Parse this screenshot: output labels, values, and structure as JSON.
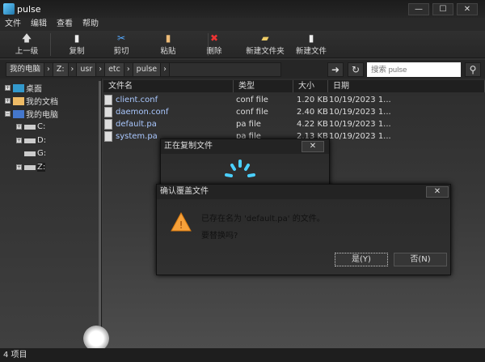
{
  "window": {
    "title": "pulse",
    "minimize": "—",
    "maximize": "☐",
    "close": "✕"
  },
  "menu": [
    "文件",
    "编辑",
    "查看",
    "帮助"
  ],
  "toolbar": {
    "up": "上一级",
    "copy": "复制",
    "cut": "剪切",
    "paste": "粘贴",
    "delete": "删除",
    "new_folder": "新建文件夹",
    "new_file": "新建文件"
  },
  "address": {
    "crumbs": [
      "我的电脑",
      "Z:",
      "usr",
      "etc",
      "pulse"
    ],
    "search_placeholder": "搜索 pulse"
  },
  "tree": {
    "desktop": "桌面",
    "documents": "我的文档",
    "computer": "我的电脑",
    "drives": [
      "C:",
      "D:",
      "G:",
      "Z:"
    ]
  },
  "columns": [
    "文件名",
    "类型",
    "大小",
    "日期"
  ],
  "files": [
    {
      "name": "client.conf",
      "type": "conf file",
      "size": "1.20 KB",
      "date": "10/19/2023 1..."
    },
    {
      "name": "daemon.conf",
      "type": "conf file",
      "size": "2.40 KB",
      "date": "10/19/2023 1..."
    },
    {
      "name": "default.pa",
      "type": "pa file",
      "size": "4.22 KB",
      "date": "10/19/2023 1..."
    },
    {
      "name": "system.pa",
      "type": "pa file",
      "size": "2.13 KB",
      "date": "10/19/2023 1..."
    }
  ],
  "copy_dialog": {
    "title": "正在复制文件",
    "close": "✕"
  },
  "confirm_dialog": {
    "title": "确认覆盖文件",
    "close": "✕",
    "message": "已存在名为 'default.pa' 的文件。",
    "question": "要替换吗?",
    "yes": "是(Y)",
    "no": "否(N)"
  },
  "status": "4 项目"
}
